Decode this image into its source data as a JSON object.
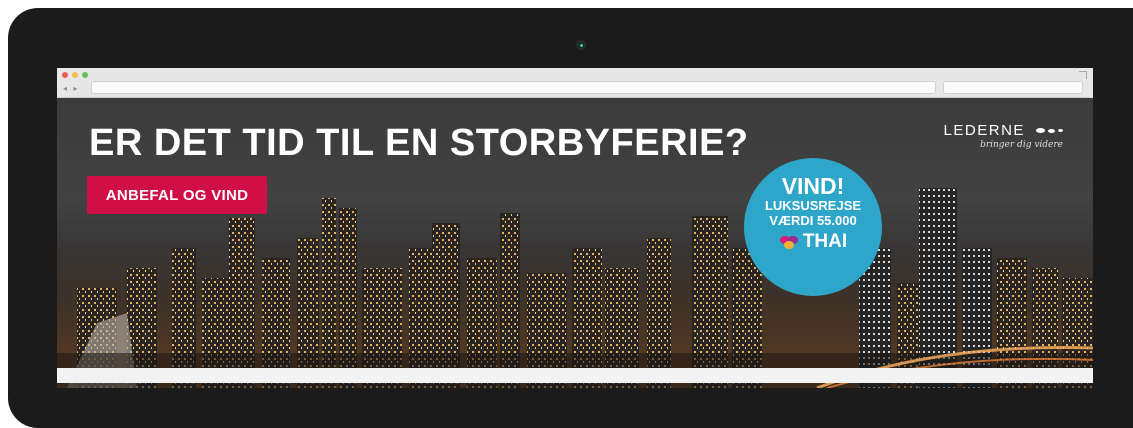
{
  "banner": {
    "headline": "ER DET TID TIL EN STORBYFERIE?",
    "cta_label": "ANBEFAL OG VIND"
  },
  "logo": {
    "name": "LEDERNE",
    "tagline": "bringer dig videre"
  },
  "badge": {
    "line1": "VIND!",
    "line2": "LUKSUSREJSE",
    "line3": "VÆRDI 55.000",
    "brand": "THAI"
  },
  "colors": {
    "device": "#1b1b1b",
    "cta": "#cf0f45",
    "badge": "#2ea6c9",
    "thai_orchid": "#d81b7b"
  },
  "icons": {
    "window_controls": [
      "close-dot-icon",
      "minimize-dot-icon",
      "maximize-dot-icon"
    ],
    "camera": "camera-dot-icon",
    "thai_logo": "orchid-icon"
  }
}
